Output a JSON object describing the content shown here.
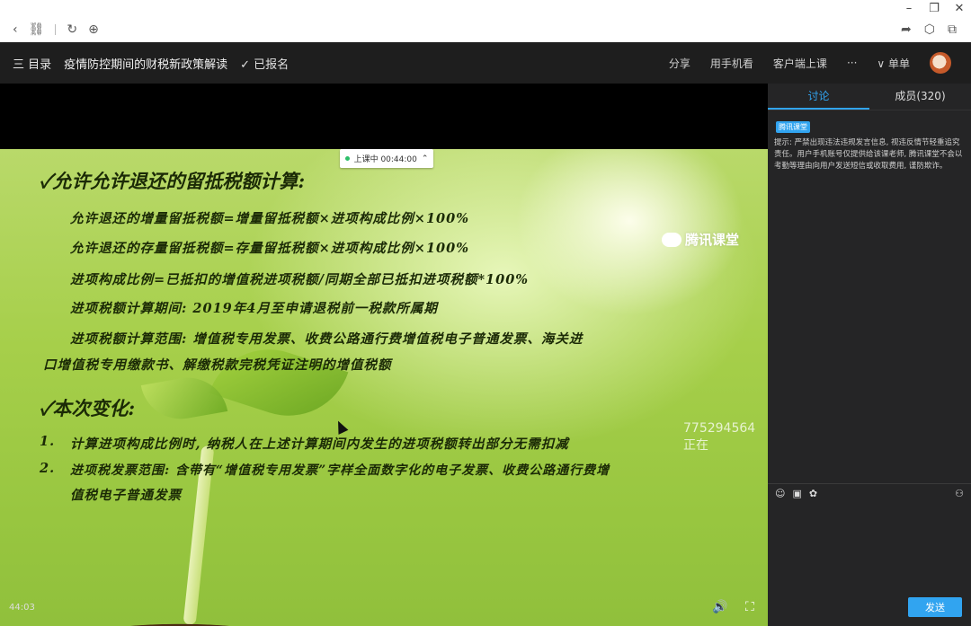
{
  "browser": {
    "window_controls": [
      "–",
      "❐",
      "✕"
    ],
    "nav_left_icons": [
      "back-icon",
      "link-icon",
      "refresh-icon",
      "globe-icon"
    ],
    "nav_right_icons": [
      "share-icon",
      "cube-icon",
      "window-icon"
    ]
  },
  "appbar": {
    "menu_label": "三 目录",
    "course_title": "疫情防控期间的财税新政策解读",
    "enrolled_label": "✓ 已报名",
    "actions": {
      "share": "分享",
      "mobile": "用手机看",
      "client": "客户端上课",
      "more": "···",
      "view_mode": "∨ 单单"
    }
  },
  "video": {
    "live_status": "上课中 00:44:00",
    "brand": "腾讯课堂",
    "watermark": "775294564正在",
    "timecode": "44:03",
    "slide": {
      "heading1": "✓允许允许退还的留抵税额计算:",
      "line1": "允许退还的增量留抵税额=增量留抵税额×进项构成比例×100%",
      "line2": "允许退还的存量留抵税额=存量留抵税额×进项构成比例×100%",
      "line3": "进项构成比例=已抵扣的增值税进项税额/同期全部已抵扣进项税额*100%",
      "line4": "进项税额计算期间: 2019年4月至申请退税前一税款所属期",
      "line5a": "进项税额计算范围: 增值税专用发票、收费公路通行费增值税电子普通发票、海关进",
      "line5b": "口增值税专用缴款书、解缴税款完税凭证注明的增值税额",
      "heading2": "✓本次变化:",
      "item1_num": "1.",
      "item1": "计算进项构成比例时, 纳税人在上述计算期间内发生的进项税额转出部分无需扣减",
      "item2_num": "2.",
      "item2a": "进项税发票范围: 含带有“增值税专用发票”字样全面数字化的电子发票、收费公路通行费增",
      "item2b": "值税电子普通发票"
    }
  },
  "sidebar": {
    "tabs": [
      {
        "label": "讨论",
        "active": true
      },
      {
        "label": "成员(320)",
        "active": false
      }
    ],
    "badge": "腾讯课堂",
    "notice": "提示: 严禁出现违法违规发言信息, 视违反情节轻重追究责任。用户手机账号仅提供给该课老师, 腾讯课堂不会以考勤等理由向用户发送短信或收取费用, 谨防欺诈。",
    "send_label": "发送"
  },
  "colors": {
    "accent": "#31a4f0",
    "appbar_bg": "#1e1e1e",
    "sidebar_bg": "#252526"
  }
}
